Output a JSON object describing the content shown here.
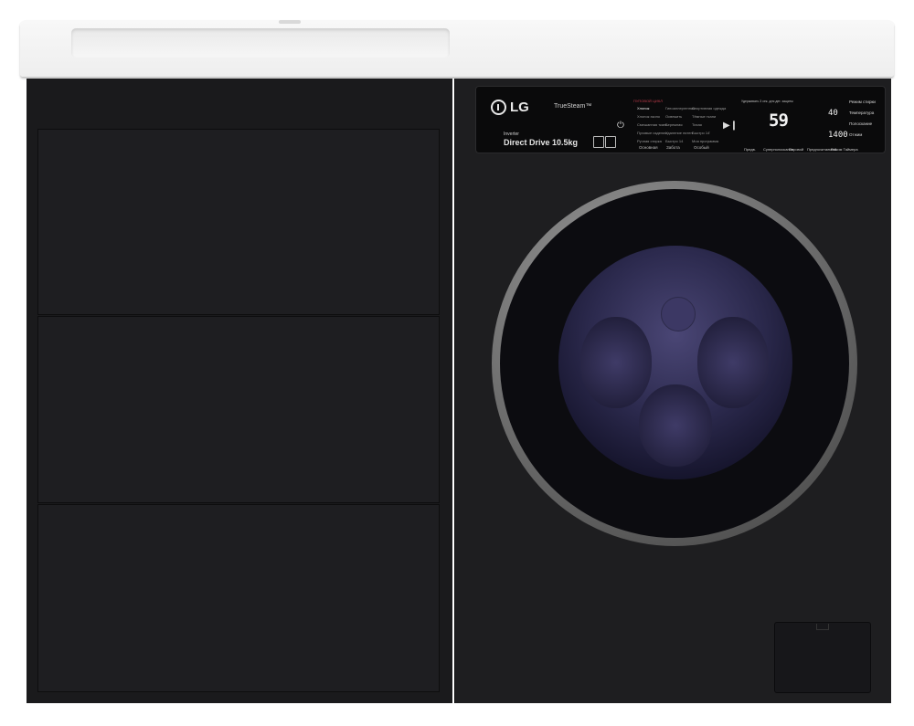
{
  "appliance": {
    "brand_logo": "LG",
    "truesteam_label": "TrueSteam™",
    "inverter_label": "Inverter",
    "capacity_label": "Direct Drive 10.5kg",
    "program_heading": "ПУПОВОЙ ЦИКЛ",
    "programs_col1": [
      "Хлопок",
      "Хлопок эконо",
      "Смешанная ткань",
      "Пуховые изделия",
      "Ручная стирка"
    ],
    "programs_col2": [
      "Гипоаллергенная",
      "Освежить",
      "Бережная",
      "Удаление пятен",
      "Быстро 14"
    ],
    "programs_col3": [
      "Спортивная одежда",
      "Тёмные ткани",
      "Тихая",
      "Быстро 14'",
      "Моя программа"
    ],
    "categories": [
      "Основная",
      "Забота",
      "Особый"
    ],
    "display_note": "Удерживать 3 сек. для дет. защиты",
    "display_time": "59",
    "display_temp": "40",
    "display_spin": "1400",
    "option_labels": [
      "Режим стирки",
      "Температура",
      "Полоскание",
      "Отжим"
    ],
    "bottom_buttons": [
      "Предв.",
      "Суперполоскание",
      "Паровой",
      "Предпочитаемый",
      "Режим Таймера"
    ],
    "colors": {
      "body": "#1e1e20",
      "countertop": "#f4f4f4",
      "door_glass": "#2c2a4e",
      "door_ring": "#8a8a8a",
      "program_accent": "#c33c4c"
    }
  }
}
